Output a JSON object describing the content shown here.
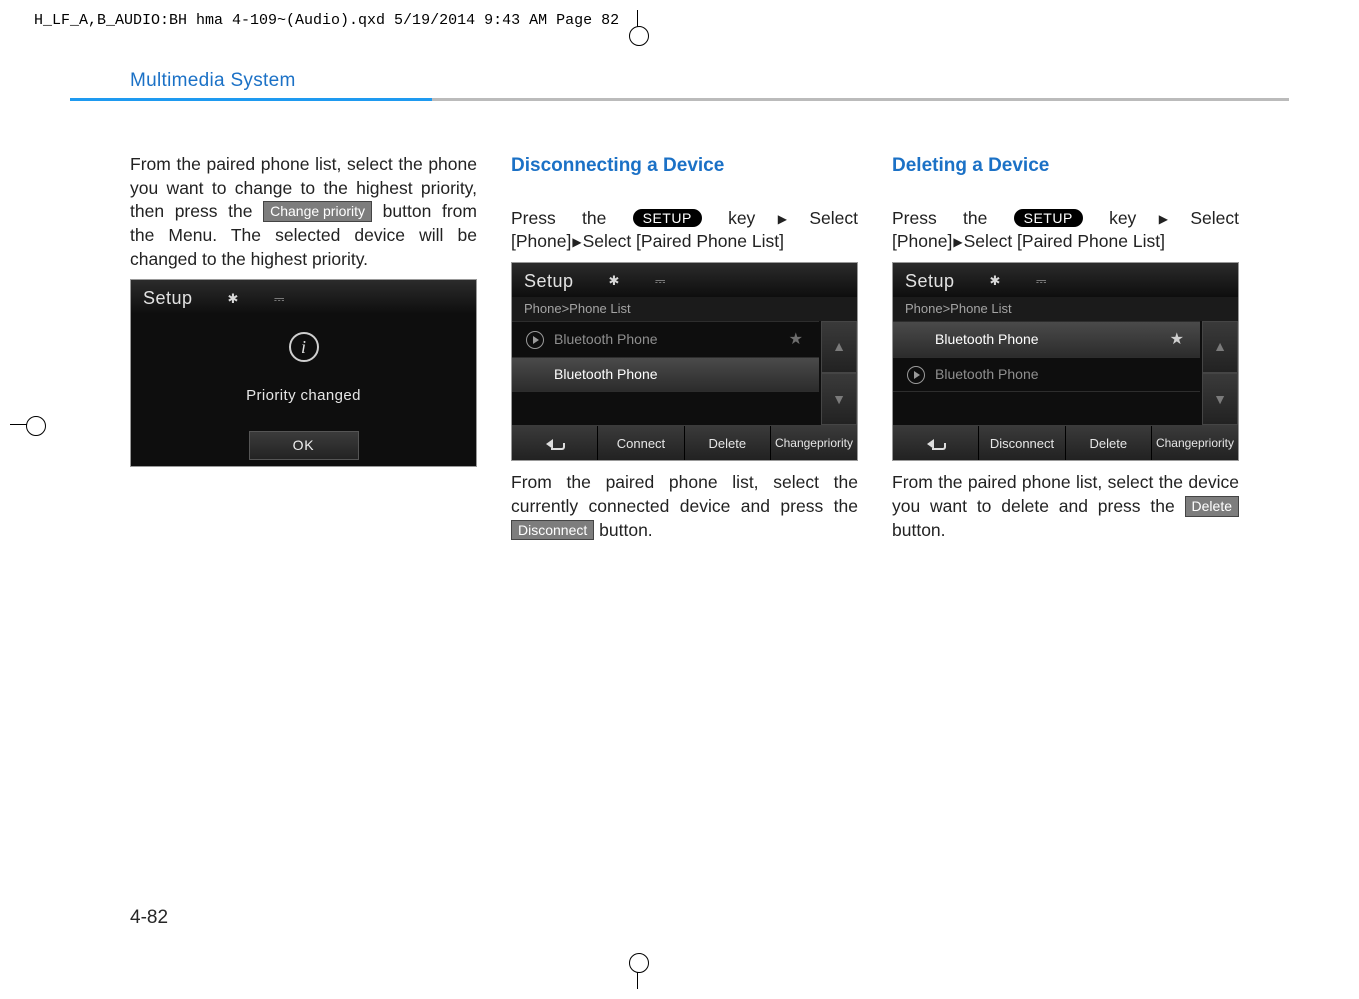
{
  "header_line": "H_LF_A,B_AUDIO:BH hma 4-109~(Audio).qxd  5/19/2014  9:43 AM  Page 82",
  "section_title": "Multimedia System",
  "page_number": "4-82",
  "col1": {
    "p1a": "From the paired phone list, select the phone you want to change to the highest priority, then press the ",
    "btn": "Change priority",
    "p1b": " button from the Menu. The selected device will be changed to the highest priority.",
    "shot": {
      "title": "Setup",
      "msg": "Priority changed",
      "ok": "OK"
    }
  },
  "col2": {
    "heading": "Disconnecting a Device",
    "p1a": "Press the ",
    "setup": "SETUP",
    "p1b": " key",
    "p1c": "Select [Phone]",
    "p1d": "Select [Paired Phone List]",
    "shot": {
      "title": "Setup",
      "breadcrumb": "Phone>Phone List",
      "row1": "Bluetooth Phone",
      "row2": "Bluetooth Phone",
      "btn_connect": "Connect",
      "btn_delete": "Delete",
      "btn_priority_l1": "Change",
      "btn_priority_l2": "priority"
    },
    "p2a": "From the paired phone list, select the currently connected device and press the ",
    "btn": "Disconnect",
    "p2b": " button."
  },
  "col3": {
    "heading": "Deleting a Device",
    "p1a": "Press the ",
    "setup": "SETUP",
    "p1b": " key",
    "p1c": "Select [Phone]",
    "p1d": "Select [Paired Phone List]",
    "shot": {
      "title": "Setup",
      "breadcrumb": "Phone>Phone List",
      "row1": "Bluetooth Phone",
      "row2": "Bluetooth Phone",
      "btn_disconnect": "Disconnect",
      "btn_delete": "Delete",
      "btn_priority_l1": "Change",
      "btn_priority_l2": "priority"
    },
    "p2a": "From the paired phone list, select the device you want to delete and press the ",
    "btn": "Delete",
    "p2b": " button."
  }
}
